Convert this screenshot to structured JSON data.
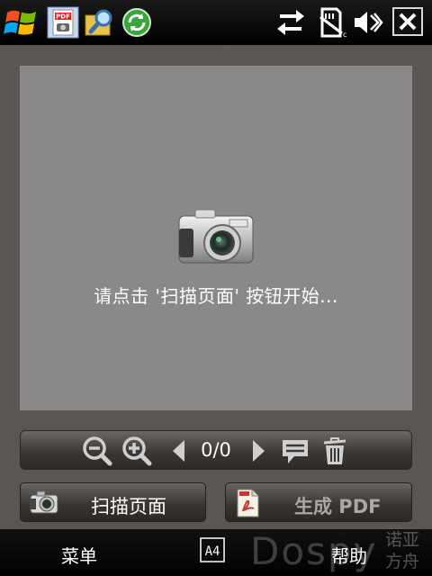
{
  "preview": {
    "hint": "请点击 '扫描页面' 按钮开始..."
  },
  "toolbar": {
    "page_counter": "0/0"
  },
  "actions": {
    "scan_label": "扫描页面",
    "pdf_label": "生成 PDF"
  },
  "softkeys": {
    "left": "菜单",
    "right": "帮助",
    "input_mode": "A4"
  },
  "watermark": {
    "brand": "Dospy",
    "cn_line1": "诺亚",
    "cn_line2": "方舟"
  },
  "icons": {
    "start": "windows-start-icon",
    "app_pdf": "pdf-scanner-app-icon",
    "app_search": "file-search-icon",
    "app_sync": "sync-icon",
    "connectivity": "connectivity-arrows-icon",
    "storage": "storage-card-icon",
    "volume": "volume-muted-icon",
    "close": "close-icon",
    "camera": "camera-icon",
    "zoom_out": "zoom-out-icon",
    "zoom_in": "zoom-in-icon",
    "prev": "chevron-left-icon",
    "next": "chevron-right-icon",
    "note": "comment-icon",
    "trash": "trash-icon",
    "pdf_doc": "pdf-document-icon"
  },
  "colors": {
    "background": "#5b5653",
    "preview": "#8b888a",
    "disabled_text": "#aaa7a4"
  }
}
